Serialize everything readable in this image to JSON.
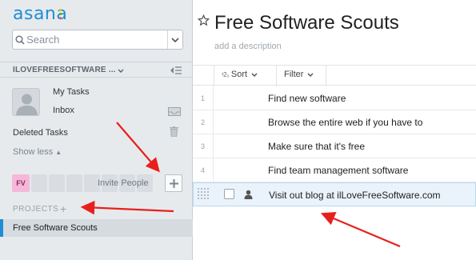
{
  "sidebar": {
    "logo_text": "asana",
    "logo_dot_colors": [
      "#ffb900",
      "#3fb800",
      "#ff5a5f"
    ],
    "search_placeholder": "Search",
    "workspace_name": "ILOVEFREESOFTWARE ...",
    "nav": {
      "my_tasks": "My Tasks",
      "inbox": "Inbox",
      "deleted_tasks": "Deleted Tasks",
      "show_less": "Show less"
    },
    "members": {
      "initials": "FV",
      "invite_label": "Invite People"
    },
    "projects_header": "PROJECTS",
    "projects": [
      {
        "label": "Free Software Scouts",
        "selected": true
      }
    ]
  },
  "main": {
    "title": "Free Software Scouts",
    "description_placeholder": "add a description",
    "toolbar": {
      "sort_label": "Sort",
      "filter_label": "Filter"
    },
    "tasks": [
      {
        "num": "1",
        "text": "Find new software"
      },
      {
        "num": "2",
        "text": "Browse the entire web if you have to"
      },
      {
        "num": "3",
        "text": "Make sure that it's free"
      },
      {
        "num": "4",
        "text": "Find team management software"
      },
      {
        "num": "",
        "text": "Visit out blog at ilLoveFreeSoftware.com"
      }
    ]
  },
  "colors": {
    "brand": "#1f8dd6",
    "annotation_arrow": "#e8201c",
    "selected_row": "#eaf3fb"
  }
}
